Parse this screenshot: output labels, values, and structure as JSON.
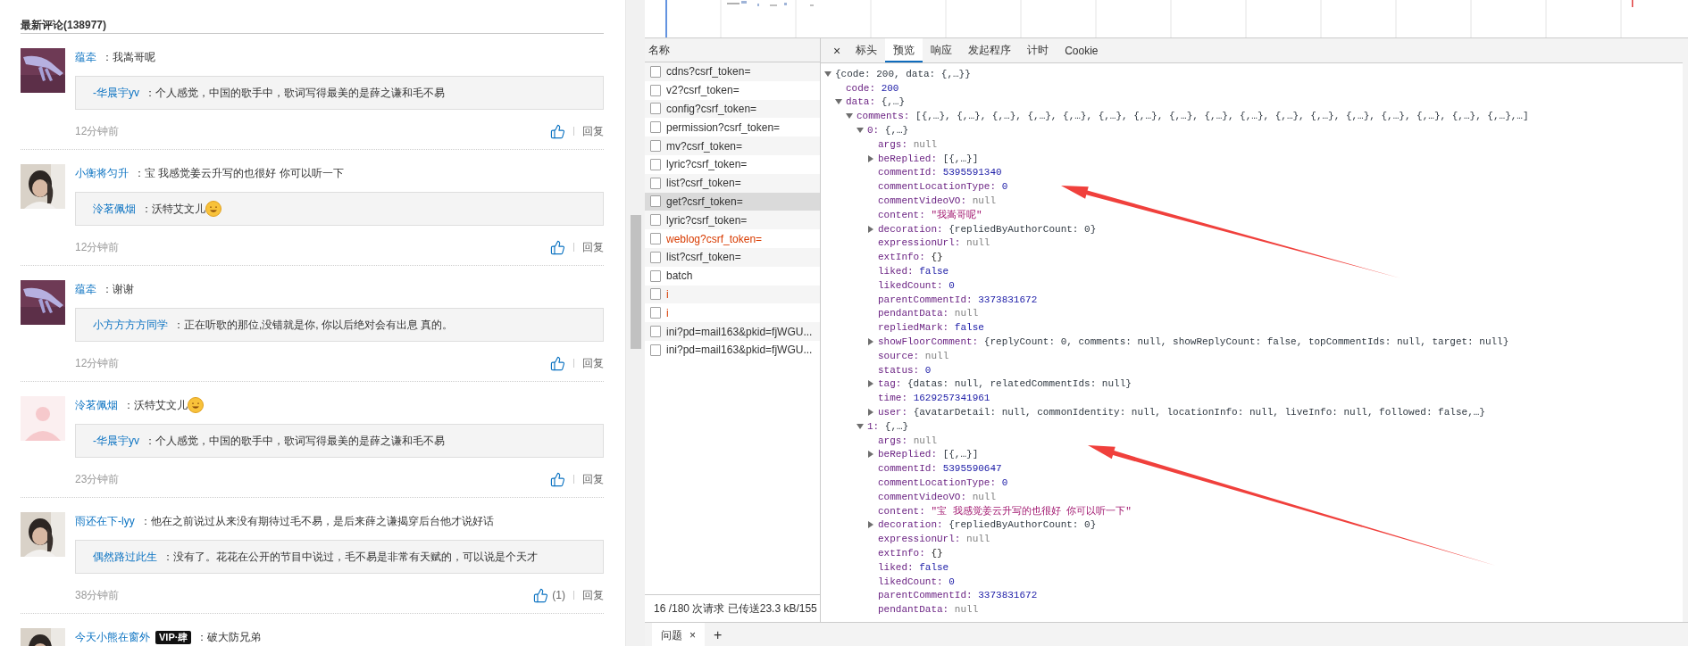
{
  "comments_section": {
    "title": "最新评论(138977)",
    "comments": [
      {
        "user": "蕴牵",
        "text": "：我嵩哥呢",
        "emoji": false,
        "reply": {
          "user": "-华晨宇yv",
          "text": "：个人感觉，中国的歌手中，歌词写得最美的是薛之谦和毛不易",
          "emoji": false
        },
        "time": "12分钟前",
        "reply_label": "回复"
      },
      {
        "user": "小衡将匀升",
        "text": "：宝 我感觉姜云升写的也很好 你可以听一下",
        "emoji": false,
        "reply": {
          "user": "泠茗佩烟",
          "text": "：沃特艾文儿",
          "emoji": true
        },
        "time": "12分钟前",
        "reply_label": "回复"
      },
      {
        "user": "蕴牵",
        "text": "：谢谢",
        "emoji": false,
        "reply": {
          "user": "小方方方方同学",
          "text": "：正在听歌的那位,没错就是你, 你以后绝对会有出息 真的。",
          "emoji": false
        },
        "time": "12分钟前",
        "reply_label": "回复"
      },
      {
        "avatar": {
          "kind": "default"
        },
        "user": "泠茗佩烟",
        "text": "：沃特艾文儿",
        "emoji": true,
        "reply": {
          "user": "-华晨宇yv",
          "text": "：个人感觉，中国的歌手中，歌词写得最美的是薛之谦和毛不易",
          "emoji": false
        },
        "time": "23分钟前",
        "reply_label": "回复"
      },
      {
        "user": "雨还在下-lyy",
        "text": "：他在之前说过从来没有期待过毛不易，是后来薛之谦揭穿后台他才说好话",
        "emoji": false,
        "reply": {
          "user": "偶然路过此生",
          "text": "：没有了。花花在公开的节目中说过，毛不易是非常有天赋的，可以说是个天才",
          "emoji": false
        },
        "time": "38分钟前",
        "like_count": "(1)",
        "reply_label": "回复"
      },
      {
        "user": "今天小熊在窗外",
        "badge": "VIP·肆",
        "text": "：破大防兄弟",
        "emoji": false
      }
    ]
  },
  "devtools": {
    "list_header": "名称",
    "requests": [
      {
        "name": "cdns?csrf_token=",
        "error": false,
        "selected": false
      },
      {
        "name": "v2?csrf_token=",
        "error": false,
        "selected": false
      },
      {
        "name": "config?csrf_token=",
        "error": false,
        "selected": false
      },
      {
        "name": "permission?csrf_token=",
        "error": false,
        "selected": false
      },
      {
        "name": "mv?csrf_token=",
        "error": false,
        "selected": false
      },
      {
        "name": "lyric?csrf_token=",
        "error": false,
        "selected": false
      },
      {
        "name": "list?csrf_token=",
        "error": false,
        "selected": false
      },
      {
        "name": "get?csrf_token=",
        "error": false,
        "selected": true
      },
      {
        "name": "lyric?csrf_token=",
        "error": false,
        "selected": false
      },
      {
        "name": "weblog?csrf_token=",
        "error": true,
        "selected": false
      },
      {
        "name": "list?csrf_token=",
        "error": false,
        "selected": false
      },
      {
        "name": "batch",
        "error": false,
        "selected": false
      },
      {
        "name": "i",
        "error": true,
        "selected": false
      },
      {
        "name": "i",
        "error": true,
        "selected": false
      },
      {
        "name": "ini?pd=mail163&pkid=fjWGU...",
        "error": false,
        "selected": false
      },
      {
        "name": "ini?pd=mail163&pkid=fjWGU...",
        "error": false,
        "selected": false
      }
    ],
    "summary": "16 /180 次请求  已传送23.3 kB/155",
    "close": "×",
    "tabs": [
      {
        "label": "标头",
        "selected": false
      },
      {
        "label": "预览",
        "selected": true
      },
      {
        "label": "响应",
        "selected": false
      },
      {
        "label": "发起程序",
        "selected": false
      },
      {
        "label": "计时",
        "selected": false
      },
      {
        "label": "Cookie",
        "selected": false
      }
    ],
    "tree": {
      "value": "{code: 200, data: {,…}}",
      "kind": "object",
      "expanded": true,
      "children": [
        {
          "key": "code:",
          "value": "200",
          "kind": "number"
        },
        {
          "key": "data:",
          "value": "{,…}",
          "kind": "object",
          "expanded": true,
          "children": [
            {
              "key": "comments:",
              "value": "[{,…}, {,…}, {,…}, {,…}, {,…}, {,…}, {,…}, {,…}, {,…}, {,…}, {,…}, {,…}, {,…}, {,…}, {,…}, {,…}, {,…},…]",
              "kind": "object",
              "expanded": true,
              "children": [
                {
                  "key": "0:",
                  "value": "{,…}",
                  "kind": "object",
                  "expanded": true,
                  "children": [
                    {
                      "key": "args:",
                      "value": "null",
                      "kind": "null"
                    },
                    {
                      "key": "beReplied:",
                      "value": "[{,…}]",
                      "kind": "object",
                      "expanded": false
                    },
                    {
                      "key": "commentId:",
                      "value": "5395591340",
                      "kind": "number"
                    },
                    {
                      "key": "commentLocationType:",
                      "value": "0",
                      "kind": "number"
                    },
                    {
                      "key": "commentVideoVO:",
                      "value": "null",
                      "kind": "null"
                    },
                    {
                      "key": "content:",
                      "value": "\"我嵩哥呢\"",
                      "kind": "string"
                    },
                    {
                      "key": "decoration:",
                      "value": "{repliedByAuthorCount: 0}",
                      "kind": "object",
                      "expanded": false
                    },
                    {
                      "key": "expressionUrl:",
                      "value": "null",
                      "kind": "null"
                    },
                    {
                      "key": "extInfo:",
                      "value": "{}",
                      "kind": "plain"
                    },
                    {
                      "key": "liked:",
                      "value": "false",
                      "kind": "number"
                    },
                    {
                      "key": "likedCount:",
                      "value": "0",
                      "kind": "number"
                    },
                    {
                      "key": "parentCommentId:",
                      "value": "3373831672",
                      "kind": "number"
                    },
                    {
                      "key": "pendantData:",
                      "value": "null",
                      "kind": "null"
                    },
                    {
                      "key": "repliedMark:",
                      "value": "false",
                      "kind": "number"
                    },
                    {
                      "key": "showFloorComment:",
                      "value": "{replyCount: 0, comments: null, showReplyCount: false, topCommentIds: null, target: null}",
                      "kind": "object",
                      "expanded": false
                    },
                    {
                      "key": "source:",
                      "value": "null",
                      "kind": "null"
                    },
                    {
                      "key": "status:",
                      "value": "0",
                      "kind": "number"
                    },
                    {
                      "key": "tag:",
                      "value": "{datas: null, relatedCommentIds: null}",
                      "kind": "object",
                      "expanded": false
                    },
                    {
                      "key": "time:",
                      "value": "1629257341961",
                      "kind": "number"
                    },
                    {
                      "key": "user:",
                      "value": "{avatarDetail: null, commonIdentity: null, locationInfo: null, liveInfo: null, followed: false,…}",
                      "kind": "object",
                      "expanded": false
                    }
                  ]
                },
                {
                  "key": "1:",
                  "value": "{,…}",
                  "kind": "object",
                  "expanded": true,
                  "children": [
                    {
                      "key": "args:",
                      "value": "null",
                      "kind": "null"
                    },
                    {
                      "key": "beReplied:",
                      "value": "[{,…}]",
                      "kind": "object",
                      "expanded": false
                    },
                    {
                      "key": "commentId:",
                      "value": "5395590647",
                      "kind": "number"
                    },
                    {
                      "key": "commentLocationType:",
                      "value": "0",
                      "kind": "number"
                    },
                    {
                      "key": "commentVideoVO:",
                      "value": "null",
                      "kind": "null"
                    },
                    {
                      "key": "content:",
                      "value": "\"宝 我感觉姜云升写的也很好 你可以听一下\"",
                      "kind": "string"
                    },
                    {
                      "key": "decoration:",
                      "value": "{repliedByAuthorCount: 0}",
                      "kind": "object",
                      "expanded": false
                    },
                    {
                      "key": "expressionUrl:",
                      "value": "null",
                      "kind": "null"
                    },
                    {
                      "key": "extInfo:",
                      "value": "{}",
                      "kind": "plain"
                    },
                    {
                      "key": "liked:",
                      "value": "false",
                      "kind": "number"
                    },
                    {
                      "key": "likedCount:",
                      "value": "0",
                      "kind": "number"
                    },
                    {
                      "key": "parentCommentId:",
                      "value": "3373831672",
                      "kind": "number"
                    },
                    {
                      "key": "pendantData:",
                      "value": "null",
                      "kind": "null"
                    }
                  ]
                }
              ]
            }
          ]
        }
      ]
    },
    "drawer": {
      "tabs": [
        {
          "label": "问题",
          "close": "×"
        }
      ],
      "add": "+"
    }
  }
}
